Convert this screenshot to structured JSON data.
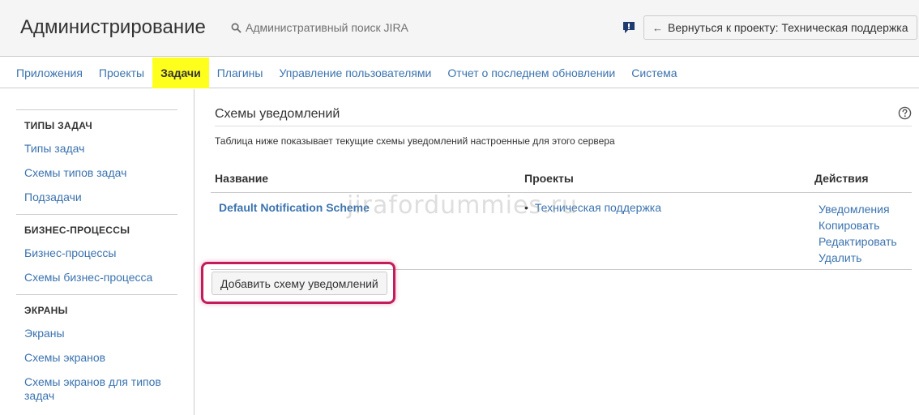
{
  "header": {
    "title": "Администрирование",
    "search_label": "Административный поиск JIRA",
    "back_button": "Вернуться к проекту: Техническая поддержка",
    "icons": {
      "search": "search-icon",
      "feedback": "feedback-icon",
      "back": "arrow-left-icon"
    }
  },
  "nav": {
    "tabs": [
      {
        "label": "Приложения"
      },
      {
        "label": "Проекты"
      },
      {
        "label": "Задачи"
      },
      {
        "label": "Плагины"
      },
      {
        "label": "Управление пользователями"
      },
      {
        "label": "Отчет о последнем обновлении"
      },
      {
        "label": "Система"
      }
    ],
    "active": "Задачи",
    "active_color": "#ffff1e"
  },
  "sidebar": {
    "sections": [
      {
        "heading": "ТИПЫ ЗАДАЧ",
        "items": [
          "Типы задач",
          "Схемы типов задач",
          "Подзадачи"
        ]
      },
      {
        "heading": "БИЗНЕС-ПРОЦЕССЫ",
        "items": [
          "Бизнес-процессы",
          "Схемы бизнес-процесса"
        ]
      },
      {
        "heading": "ЭКРАНЫ",
        "items": [
          "Экраны",
          "Схемы экранов",
          "Схемы экранов для типов задач"
        ]
      }
    ]
  },
  "main": {
    "title": "Схемы уведомлений",
    "description": "Таблица ниже показывает текущие схемы уведомлений настроенные для этого сервера",
    "table": {
      "headers": {
        "name": "Название",
        "projects": "Проекты",
        "actions": "Действия"
      },
      "rows": [
        {
          "name": "Default Notification Scheme",
          "project": "Техническая поддержка",
          "actions": [
            "Уведомления",
            "Копировать",
            "Редактировать",
            "Удалить"
          ]
        }
      ]
    },
    "add_button": "Добавить схему уведомлений",
    "highlight_color": "#c21d5a"
  },
  "watermark": "jirafordummies.ru",
  "colors": {
    "link": "#3b73af",
    "header_bg": "#f5f5f5",
    "border": "#cccccc"
  }
}
